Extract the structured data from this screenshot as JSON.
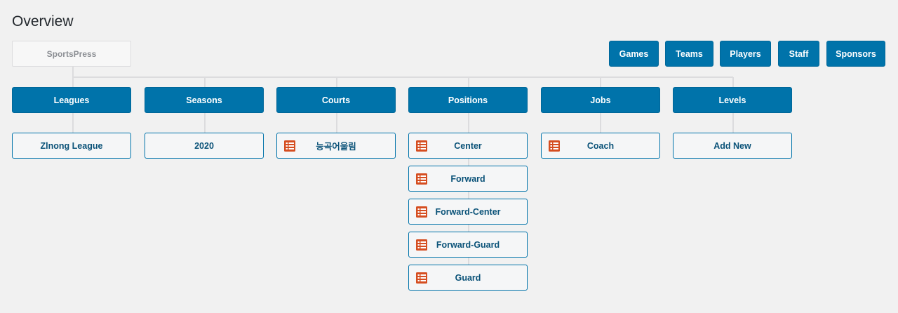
{
  "page": {
    "title": "Overview"
  },
  "root": {
    "label": "SportsPress"
  },
  "top_nav": [
    {
      "id": "games",
      "label": "Games"
    },
    {
      "id": "teams",
      "label": "Teams"
    },
    {
      "id": "players",
      "label": "Players"
    },
    {
      "id": "staff",
      "label": "Staff"
    },
    {
      "id": "sponsors",
      "label": "Sponsors"
    }
  ],
  "categories": [
    {
      "id": "leagues",
      "label": "Leagues",
      "children": [
        {
          "label": "Zlnong League",
          "icon": null
        }
      ]
    },
    {
      "id": "seasons",
      "label": "Seasons",
      "children": [
        {
          "label": "2020",
          "icon": null
        }
      ]
    },
    {
      "id": "courts",
      "label": "Courts",
      "children": [
        {
          "label": "능곡어울림",
          "icon": "list-icon"
        }
      ]
    },
    {
      "id": "positions",
      "label": "Positions",
      "children": [
        {
          "label": "Center",
          "icon": "list-icon"
        },
        {
          "label": "Forward",
          "icon": "list-icon"
        },
        {
          "label": "Forward-Center",
          "icon": "list-icon"
        },
        {
          "label": "Forward-Guard",
          "icon": "list-icon"
        },
        {
          "label": "Guard",
          "icon": "list-icon"
        }
      ]
    },
    {
      "id": "jobs",
      "label": "Jobs",
      "children": [
        {
          "label": "Coach",
          "icon": "list-icon"
        }
      ]
    },
    {
      "id": "levels",
      "label": "Levels",
      "children": [
        {
          "label": "Add New",
          "icon": null
        }
      ]
    }
  ],
  "colors": {
    "primary": "#0073aa",
    "icon": "#d54e21",
    "child_text": "#0a5278",
    "connector": "#dcdcde",
    "background": "#f1f1f1"
  }
}
